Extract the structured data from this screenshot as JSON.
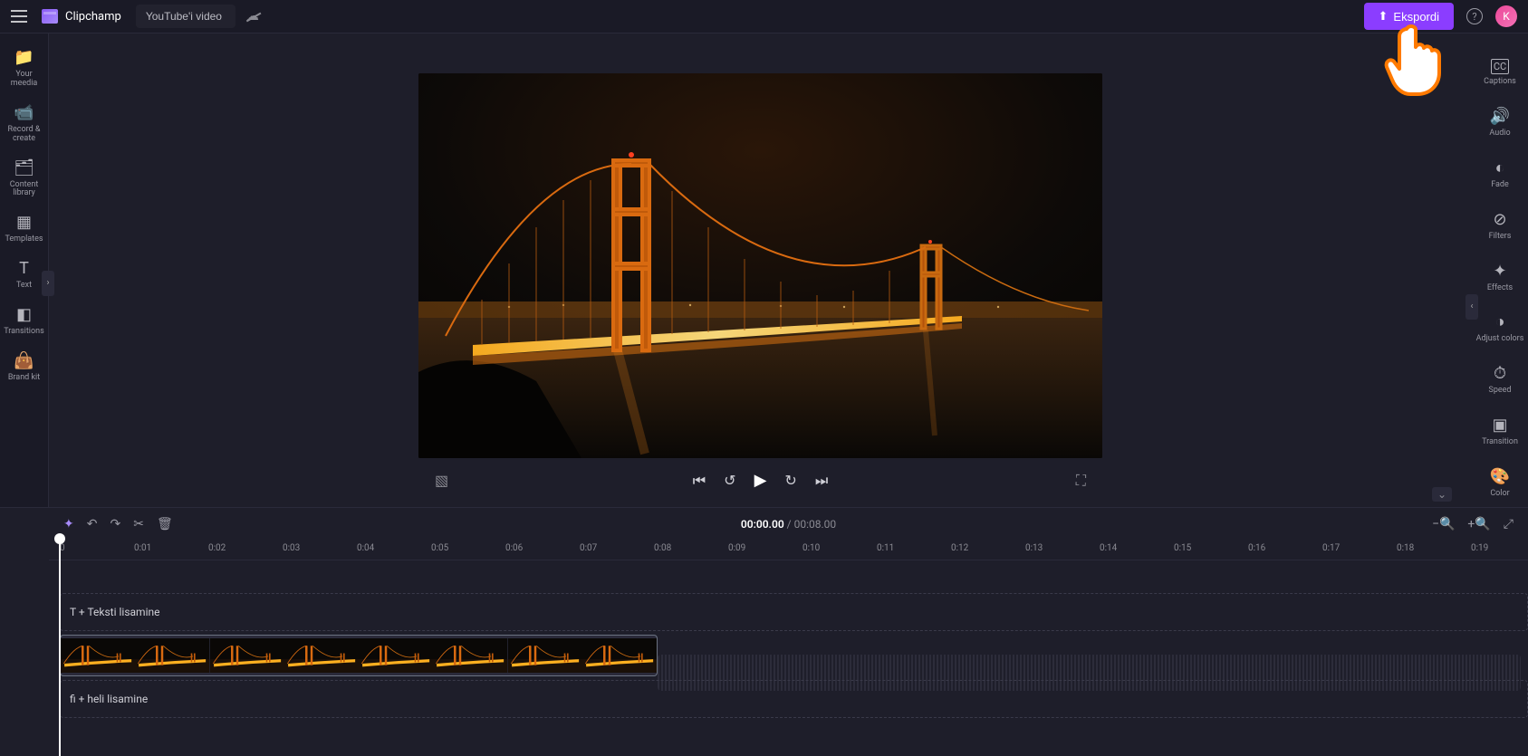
{
  "header": {
    "app_name": "Clipchamp",
    "project_title": "YouTube'i video",
    "export_label": "Ekspordi",
    "avatar_initial": "K"
  },
  "left_sidebar": {
    "items": [
      {
        "icon": "folder-icon",
        "glyph": "📁",
        "label": "Your meedia"
      },
      {
        "icon": "camera-icon",
        "glyph": "📹",
        "label": "Record & create"
      },
      {
        "icon": "library-icon",
        "glyph": "🗂",
        "label": "Content library"
      },
      {
        "icon": "templates-icon",
        "glyph": "▦",
        "label": "Templates"
      },
      {
        "icon": "text-icon",
        "glyph": "T",
        "label": "Text"
      },
      {
        "icon": "transitions-icon",
        "glyph": "◧",
        "label": "Transitions"
      },
      {
        "icon": "brand-icon",
        "glyph": "👜",
        "label": "Brand kit"
      }
    ]
  },
  "right_sidebar": {
    "items": [
      {
        "icon": "captions-icon",
        "glyph": "CC",
        "label": "Captions"
      },
      {
        "icon": "audio-icon",
        "glyph": "🔊",
        "label": "Audio"
      },
      {
        "icon": "fade-icon",
        "glyph": "◐",
        "label": "Fade"
      },
      {
        "icon": "filters-icon",
        "glyph": "⊘",
        "label": "Filters"
      },
      {
        "icon": "effects-icon",
        "glyph": "✦",
        "label": "Effects"
      },
      {
        "icon": "adjust-icon",
        "glyph": "◑",
        "label": "Adjust colors"
      },
      {
        "icon": "speed-icon",
        "glyph": "⏱",
        "label": "Speed"
      },
      {
        "icon": "transition-icon",
        "glyph": "▣",
        "label": "Transition"
      },
      {
        "icon": "color-icon",
        "glyph": "🎨",
        "label": "Color"
      }
    ]
  },
  "player": {
    "time_current": "00:00.00",
    "time_total": "00:08.00"
  },
  "timeline": {
    "ticks": [
      "0",
      "0:01",
      "0:02",
      "0:03",
      "0:04",
      "0:05",
      "0:06",
      "0:07",
      "0:08",
      "0:09",
      "0:10",
      "0:11",
      "0:12",
      "0:13",
      "0:14",
      "0:15",
      "0:16",
      "0:17",
      "0:18",
      "0:19"
    ],
    "tick_spacing_px": 82,
    "text_track_label": "T + Teksti lisamine",
    "audio_track_label": "fi + heli lisamine",
    "clip_thumbs": 8
  }
}
